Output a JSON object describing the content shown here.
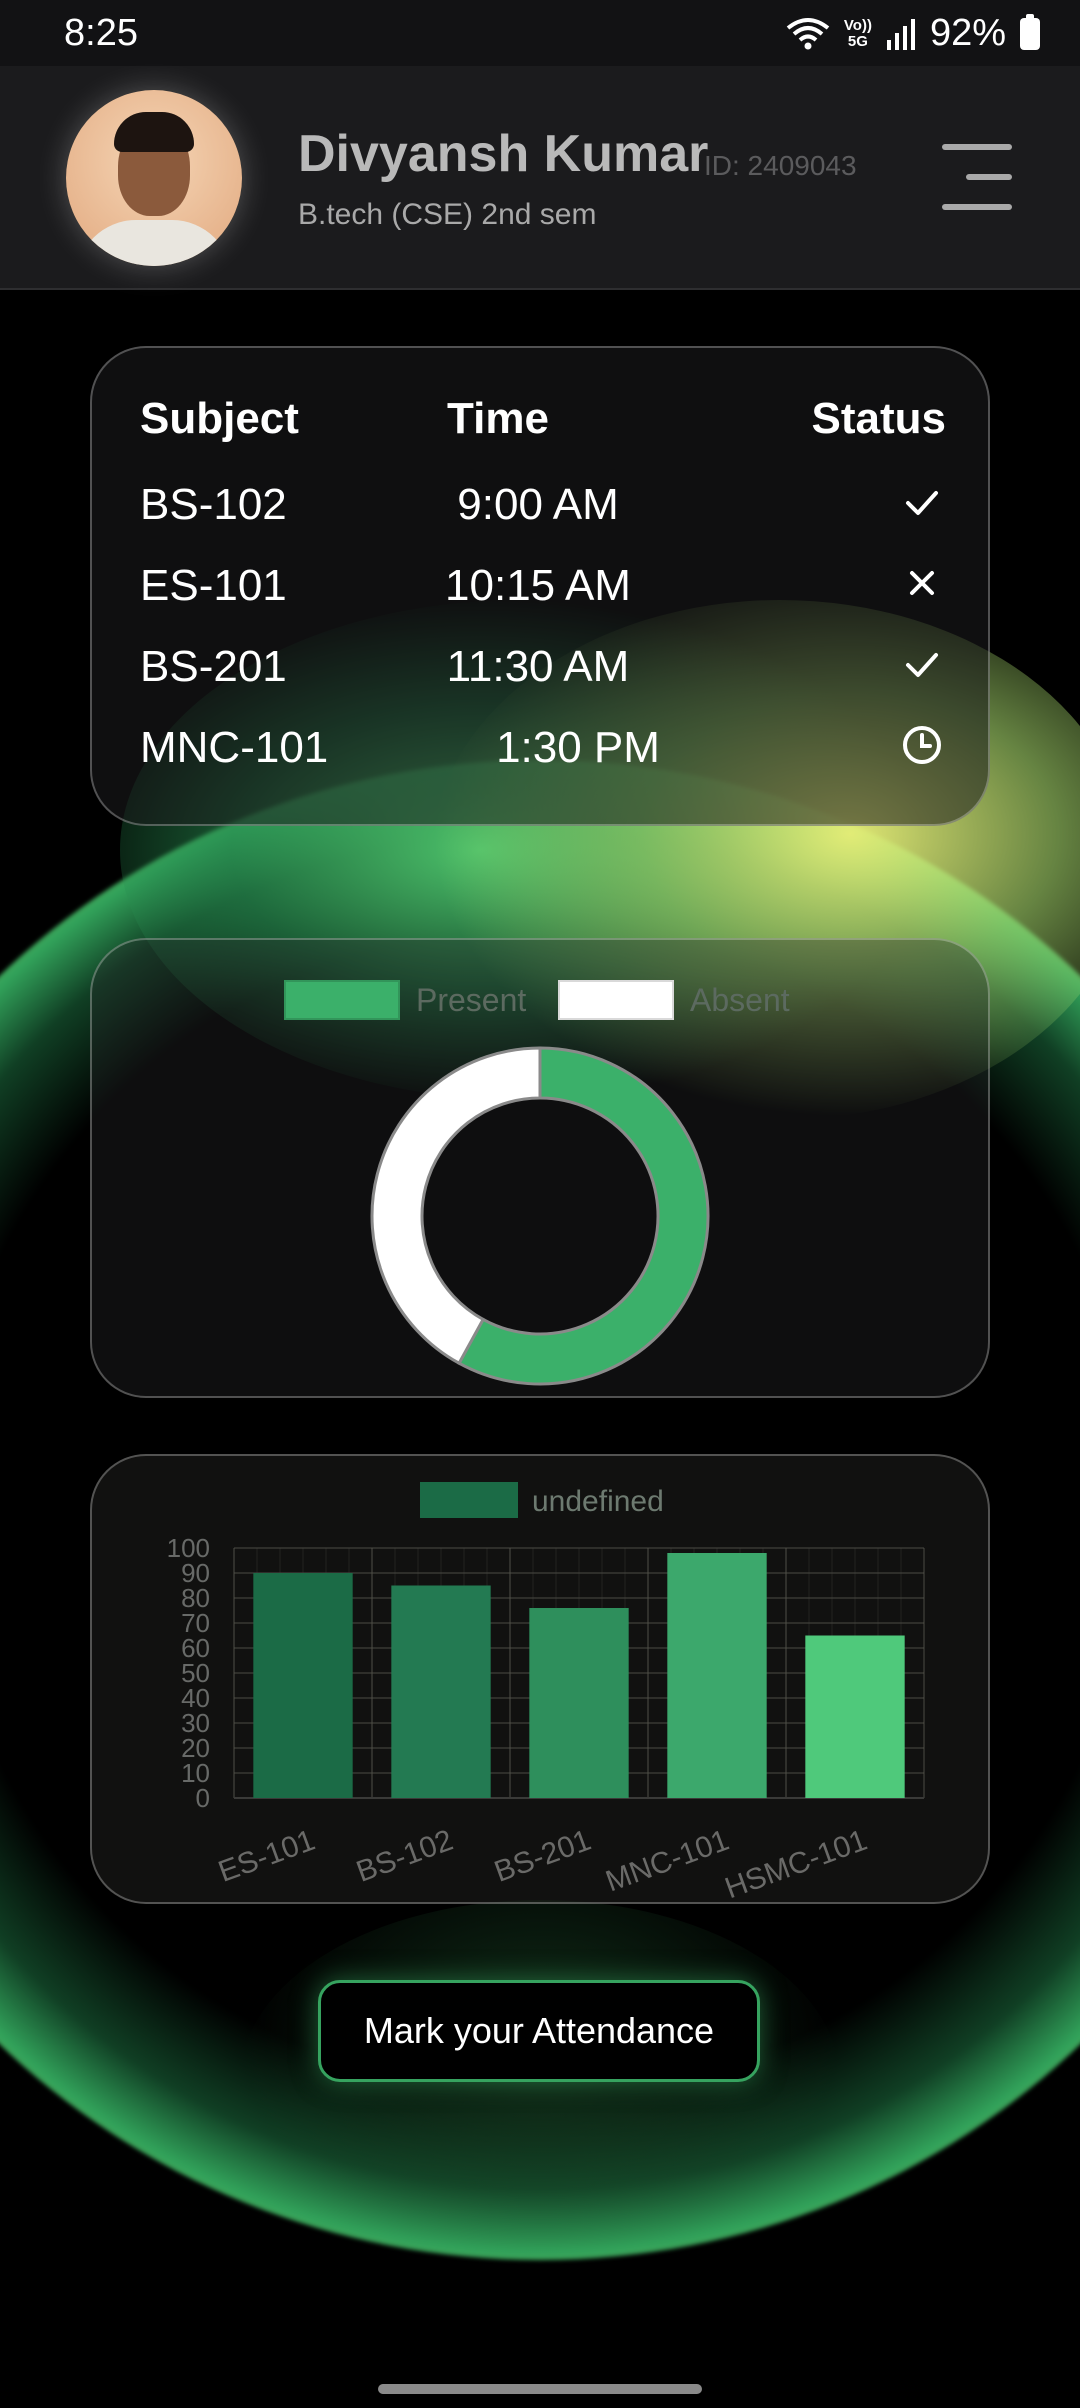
{
  "status_bar": {
    "time": "8:25",
    "volte_top": "Vo))",
    "volte_bottom": "5G",
    "battery": "92%"
  },
  "header": {
    "name": "Divyansh Kumar",
    "id": "ID: 2409043",
    "course": "B.tech (CSE) 2nd sem",
    "menu_icon": "hamburger-menu-icon",
    "avatar": "profile-photo"
  },
  "schedule": {
    "headers": {
      "subject": "Subject",
      "time": "Time",
      "status": "Status"
    },
    "rows": [
      {
        "subject": "BS-102",
        "time": "9:00 AM",
        "status": "check-icon"
      },
      {
        "subject": "ES-101",
        "time": "10:15 AM",
        "status": "cross-icon"
      },
      {
        "subject": "BS-201",
        "time": "11:30 AM",
        "status": "check-icon"
      },
      {
        "subject": "MNC-101",
        "time": "1:30 PM",
        "status": "clock-icon"
      }
    ]
  },
  "chart_data": [
    {
      "type": "pie",
      "variant": "doughnut",
      "legend": [
        "Present",
        "Absent"
      ],
      "values": [
        58,
        42
      ],
      "colors": [
        "#3bb06a",
        "#ffffff"
      ],
      "legend_position": "top"
    },
    {
      "type": "bar",
      "legend": [
        "undefined"
      ],
      "categories": [
        "ES-101",
        "BS-102",
        "BS-201",
        "MNC-101",
        "HSMC-101"
      ],
      "values": [
        90,
        85,
        76,
        98,
        65
      ],
      "colors": [
        "#1b6b46",
        "#237a52",
        "#2e8f5c",
        "#3ca86c",
        "#4fc97b"
      ],
      "ylim": [
        0,
        100
      ],
      "yticks": [
        0,
        10,
        20,
        30,
        40,
        50,
        60,
        70,
        80,
        90,
        100
      ],
      "grid": true,
      "legend_position": "top"
    }
  ],
  "action": {
    "mark_attendance": "Mark your Attendance"
  },
  "colors": {
    "accent": "#36a35f",
    "background": "#000000",
    "header": "#1b1b1d"
  }
}
